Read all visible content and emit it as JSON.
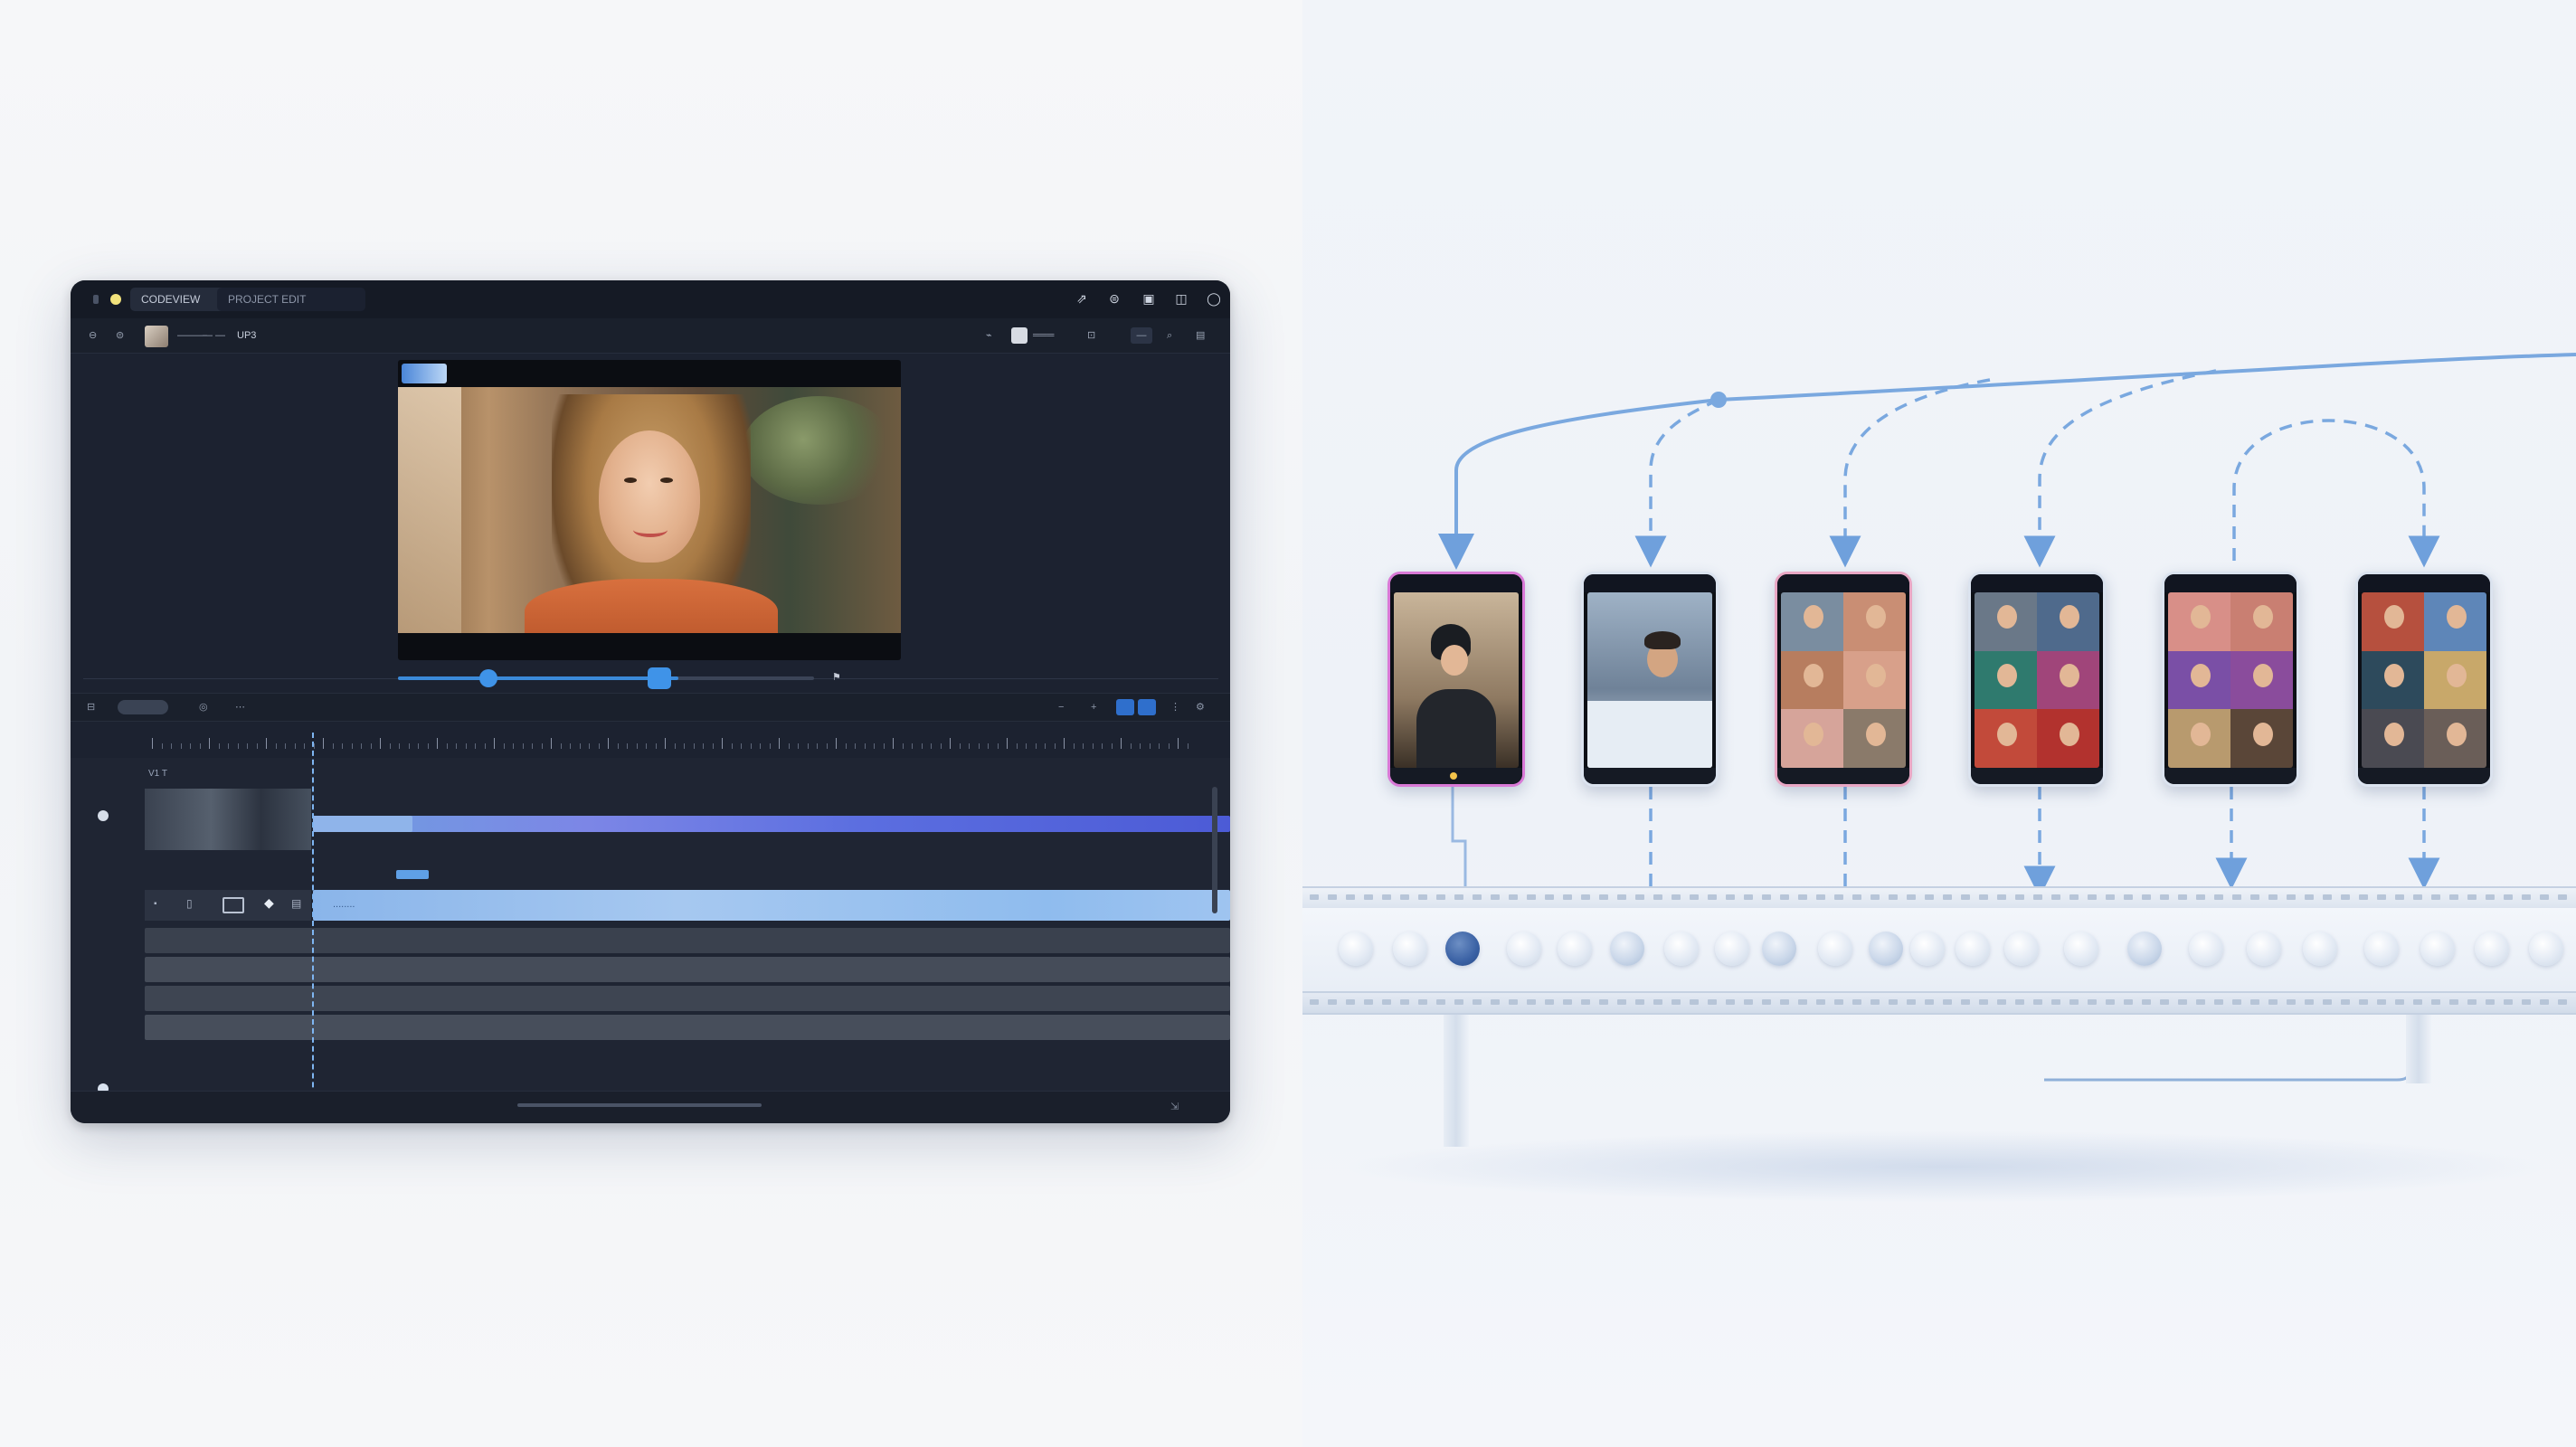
{
  "editor": {
    "tabs": [
      {
        "label": "CODEVIEW"
      },
      {
        "label": "PROJECT EDIT"
      }
    ],
    "toolbar": {
      "label_a": "———",
      "label_b": "— —",
      "counter": "UP3",
      "zoom_label": "═══"
    },
    "tracks": {
      "video_label": "V1 T",
      "text_clip_label": "........"
    },
    "colors": {
      "accent": "#3f93e8",
      "clip_video": "#5b6ee0",
      "clip_audio": "#8fbcee",
      "panel": "#1c2230"
    },
    "icons": [
      "minimize-icon",
      "layout-icon",
      "export-icon",
      "cloud-icon",
      "settings-icon",
      "user-icon"
    ]
  },
  "diagram": {
    "phones": [
      {
        "border": "pink",
        "layout": "single"
      },
      {
        "border": "plain",
        "layout": "single"
      },
      {
        "border": "pinkish",
        "layout": "grid"
      },
      {
        "border": "plain",
        "layout": "grid"
      },
      {
        "border": "plain",
        "layout": "grid"
      },
      {
        "border": "plain",
        "layout": "grid"
      }
    ],
    "colors": {
      "flow_line": "#6fa0dc",
      "phone_highlight": "#d979d6"
    }
  }
}
